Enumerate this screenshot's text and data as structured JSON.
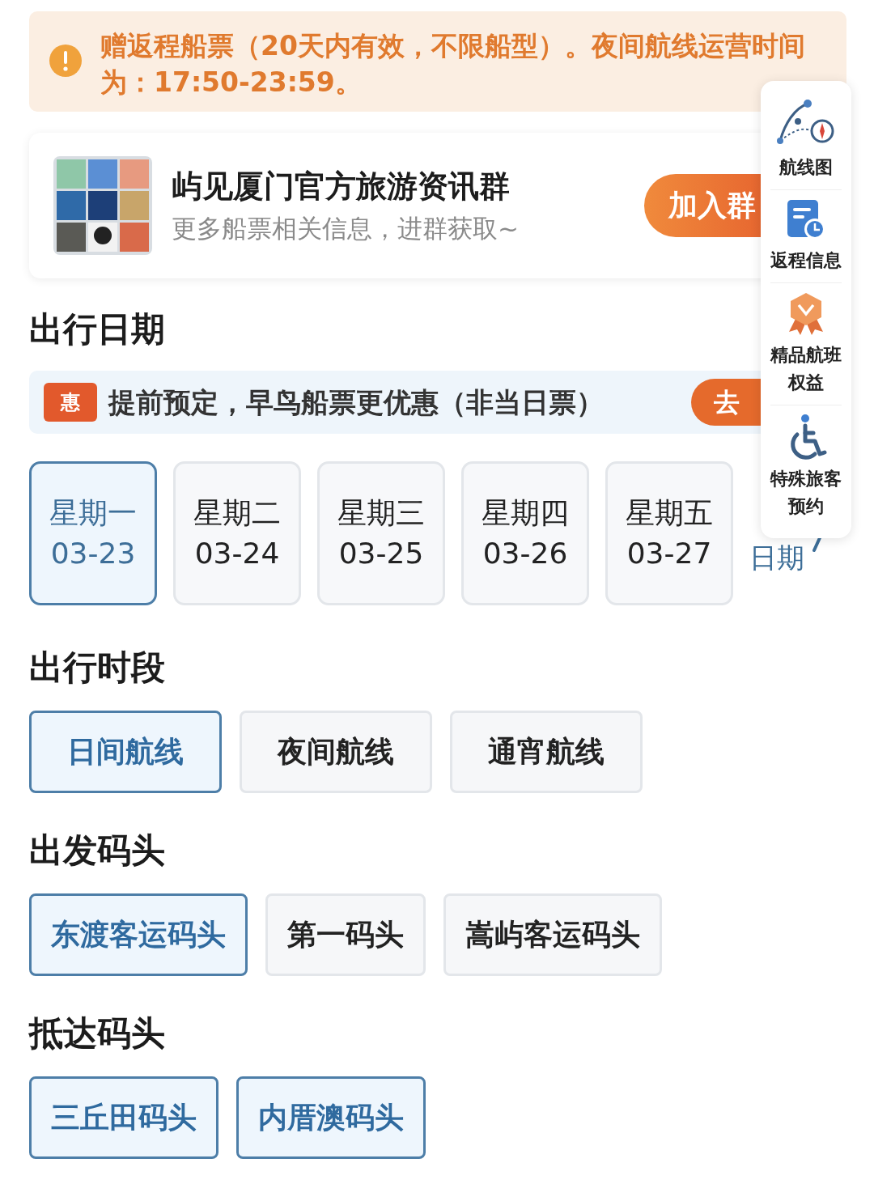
{
  "notice": {
    "text": "赠返程船票（20天内有效，不限船型）。夜间航线运营时间为：17:50-23:59。"
  },
  "group_card": {
    "title": "屿见厦门官方旅游资讯群",
    "subtitle": "更多船票相关信息，进群获取~",
    "button": "加入群"
  },
  "side_menu": [
    {
      "label": "航线图",
      "kind": "route"
    },
    {
      "label": "返程信息",
      "kind": "return"
    },
    {
      "label": "精品航班权益",
      "kind": "badge"
    },
    {
      "label": "特殊旅客预约",
      "kind": "accessible"
    }
  ],
  "travel_date": {
    "title": "出行日期",
    "promo": {
      "badge": "惠",
      "text": "提前预定，早鸟船票更优惠（非当日票）",
      "button": "去"
    },
    "dates": [
      {
        "weekday": "星期一",
        "date": "03-23",
        "selected": true
      },
      {
        "weekday": "星期二",
        "date": "03-24",
        "selected": false
      },
      {
        "weekday": "星期三",
        "date": "03-25",
        "selected": false
      },
      {
        "weekday": "星期四",
        "date": "03-26",
        "selected": false
      },
      {
        "weekday": "星期五",
        "date": "03-27",
        "selected": false
      }
    ],
    "more": "日期"
  },
  "time_slot": {
    "title": "出行时段",
    "options": [
      {
        "label": "日间航线",
        "selected": true
      },
      {
        "label": "夜间航线",
        "selected": false
      },
      {
        "label": "通宵航线",
        "selected": false
      }
    ]
  },
  "departure": {
    "title": "出发码头",
    "options": [
      {
        "label": "东渡客运码头",
        "selected": true
      },
      {
        "label": "第一码头",
        "selected": false
      },
      {
        "label": "嵩屿客运码头",
        "selected": false
      }
    ]
  },
  "arrival": {
    "title": "抵达码头",
    "options": [
      {
        "label": "三丘田码头",
        "selected": true
      },
      {
        "label": "内厝澳码头",
        "selected": true
      }
    ]
  }
}
